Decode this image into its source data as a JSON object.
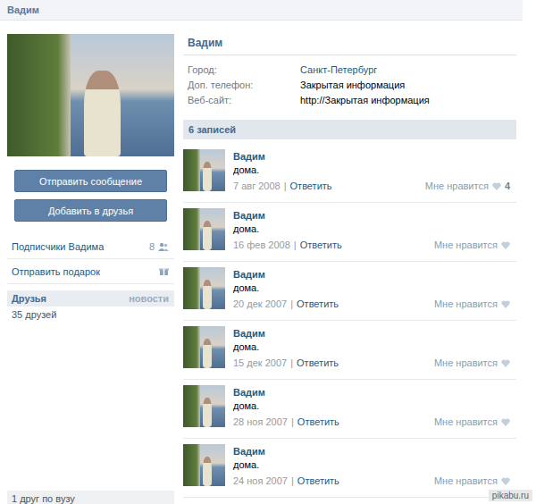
{
  "header": {
    "title": "Вадим"
  },
  "profile": {
    "name": "Вадим",
    "info": [
      {
        "label": "Город:",
        "value": "Санкт-Петербург",
        "link": true
      },
      {
        "label": "Доп. телефон:",
        "value": "Закрытая информация",
        "link": false
      },
      {
        "label": "Веб-сайт:",
        "value": "http://Закрытая информация",
        "link": false
      }
    ]
  },
  "actions": [
    "Отправить сообщение",
    "Добавить в друзья"
  ],
  "sidebar": {
    "items": [
      {
        "label": "Подписчики Вадима",
        "count": "8",
        "kind": "people"
      },
      {
        "label": "Отправить подарок",
        "count": "",
        "kind": "gift"
      }
    ]
  },
  "friends": {
    "title": "Друзья",
    "link": "новости",
    "count": "35 друзей",
    "footer": "1 друг по вузу"
  },
  "wall": {
    "title": "6 записей",
    "posts": [
      {
        "author": "Вадим",
        "text": "дома.",
        "date": "7 авг 2008",
        "separator": "|",
        "reply": "Ответить",
        "like_label": "Мне нравится",
        "likes": "4"
      },
      {
        "author": "Вадим",
        "text": "дома.",
        "date": "16 фев 2008",
        "separator": "|",
        "reply": "Ответить",
        "like_label": "Мне нравится",
        "likes": ""
      },
      {
        "author": "Вадим",
        "text": "дома.",
        "date": "20 дек 2007",
        "separator": "|",
        "reply": "Ответить",
        "like_label": "Мне нравится",
        "likes": ""
      },
      {
        "author": "Вадим",
        "text": "дома.",
        "date": "15 дек 2007",
        "separator": "|",
        "reply": "Ответить",
        "like_label": "Мне нравится",
        "likes": ""
      },
      {
        "author": "Вадим",
        "text": "дома.",
        "date": "28 ноя 2007",
        "separator": "|",
        "reply": "Ответить",
        "like_label": "Мне нравится",
        "likes": ""
      },
      {
        "author": "Вадим",
        "text": "дома.",
        "date": "24 ноя 2007",
        "separator": "|",
        "reply": "Ответить",
        "like_label": "Мне нравится",
        "likes": ""
      }
    ]
  },
  "watermark": "pikabu.ru"
}
